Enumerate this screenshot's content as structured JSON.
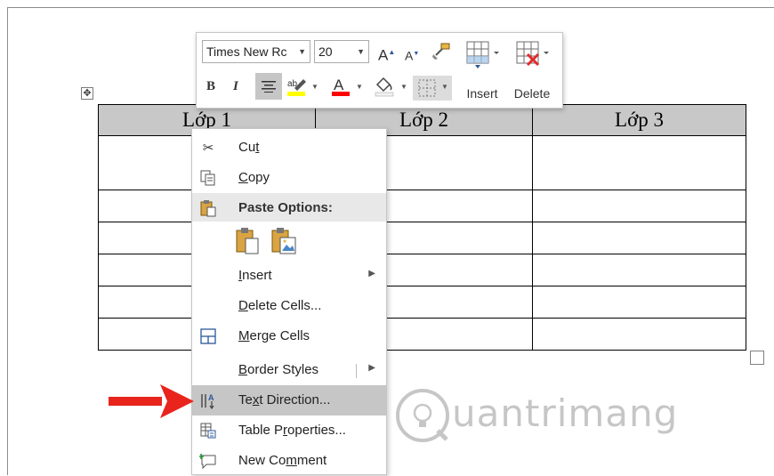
{
  "table": {
    "headers": [
      "Lớp 1",
      "Lớp 2",
      "Lớp 3"
    ],
    "body_rows": 6
  },
  "mini_toolbar": {
    "font_name": "Times New Rc",
    "font_size": "20",
    "bold_label": "B",
    "italic_label": "I",
    "insert_label": "Insert",
    "delete_label": "Delete",
    "icons": [
      "grow-font-icon",
      "shrink-font-icon",
      "format-painter-icon",
      "center-align-icon",
      "highlight-icon",
      "font-color-icon",
      "shading-icon",
      "borders-icon",
      "insert-table-icon",
      "delete-table-icon"
    ]
  },
  "context_menu": {
    "items": [
      {
        "label": "Cut",
        "icon": "scissors-icon",
        "underline_index": 2
      },
      {
        "label": "Copy",
        "icon": "copy-icon",
        "underline_index": 0
      },
      {
        "label": "Paste Options:",
        "icon": "paste-icon",
        "header": true
      },
      {
        "label": "Insert",
        "submenu": true
      },
      {
        "label": "Delete Cells...",
        "underline_index": 0
      },
      {
        "label": "Merge Cells",
        "icon": "merge-cells-icon",
        "underline_index": 0
      },
      {
        "label": "Border Styles",
        "submenu": true
      },
      {
        "label": "Text Direction...",
        "icon": "text-direction-icon",
        "highlighted": true
      },
      {
        "label": "Table Properties...",
        "icon": "table-properties-icon"
      },
      {
        "label": "New Comment",
        "icon": "new-comment-icon"
      }
    ],
    "paste_option_icons": [
      "paste-keep-formatting-icon",
      "paste-picture-icon"
    ]
  },
  "watermark": {
    "text": "uantrimang"
  },
  "colors": {
    "highlight_yellow": "#ffff00",
    "font_red": "#ff0000",
    "arrow_red": "#e8241c",
    "header_gray": "#c8c8c8",
    "hover_gray": "#c6c6c6"
  }
}
